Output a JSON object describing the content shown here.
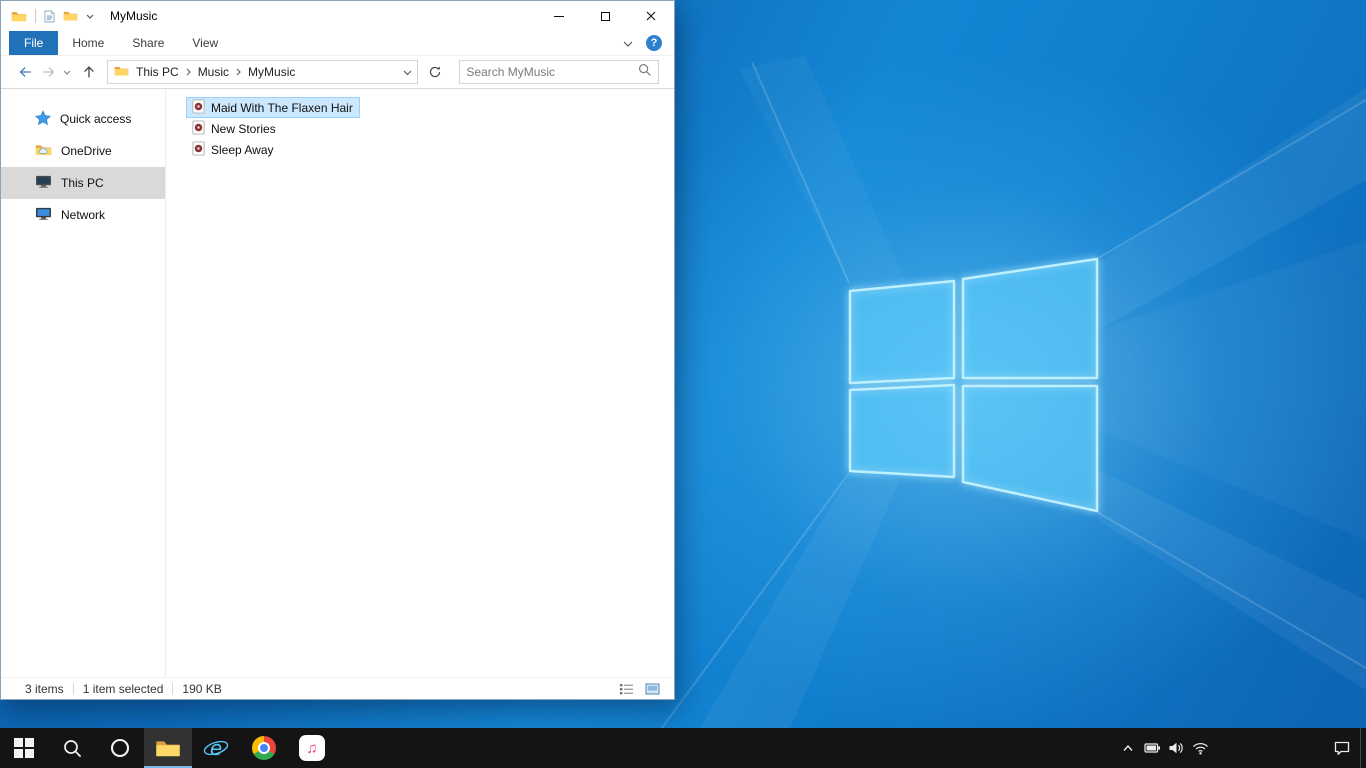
{
  "explorer": {
    "titlebar": {
      "title": "MyMusic"
    },
    "ribbon": {
      "file": "File",
      "tabs": [
        "Home",
        "Share",
        "View"
      ],
      "help": "?"
    },
    "navbar": {
      "crumbs": [
        "This PC",
        "Music",
        "MyMusic"
      ],
      "search_placeholder": "Search MyMusic"
    },
    "sidebar": {
      "items": [
        {
          "label": "Quick access",
          "icon": "quick-access-star-icon"
        },
        {
          "label": "OneDrive",
          "icon": "onedrive-folder-icon"
        },
        {
          "label": "This PC",
          "icon": "this-pc-monitor-icon",
          "selected": true
        },
        {
          "label": "Network",
          "icon": "network-monitor-icon"
        }
      ]
    },
    "files": [
      {
        "name": "Maid With The Flaxen Hair",
        "icon": "audio-file-icon",
        "selected": true
      },
      {
        "name": "New Stories",
        "icon": "audio-file-icon",
        "selected": false
      },
      {
        "name": "Sleep Away",
        "icon": "audio-file-icon",
        "selected": false
      }
    ],
    "statusbar": {
      "count": "3 items",
      "selected": "1 item selected",
      "size": "190 KB"
    }
  },
  "taskbar": {
    "apps": [
      {
        "name": "start",
        "icon": "windows-logo-icon"
      },
      {
        "name": "search",
        "icon": "search-icon"
      },
      {
        "name": "cortana",
        "icon": "cortana-ring-icon"
      },
      {
        "name": "file-explorer",
        "icon": "folder-icon",
        "active": true
      },
      {
        "name": "internet-explorer",
        "icon": "ie-icon"
      },
      {
        "name": "chrome",
        "icon": "chrome-icon"
      },
      {
        "name": "itunes",
        "icon": "music-note-icon"
      }
    ],
    "tray": [
      "hidden-icons-chevron",
      "battery",
      "volume",
      "wifi",
      "action-center"
    ]
  },
  "colors": {
    "file_tab_blue": "#2272b9",
    "selection_bg": "#cce8ff",
    "selection_border": "#99d1ff",
    "sidebar_selected_bg": "#d9d9d9",
    "taskbar_bg": "#141414",
    "taskbar_active_underline": "#76b9ed",
    "wallpaper_blue": "#1486d4",
    "folder_yellow": "#ffd664"
  }
}
